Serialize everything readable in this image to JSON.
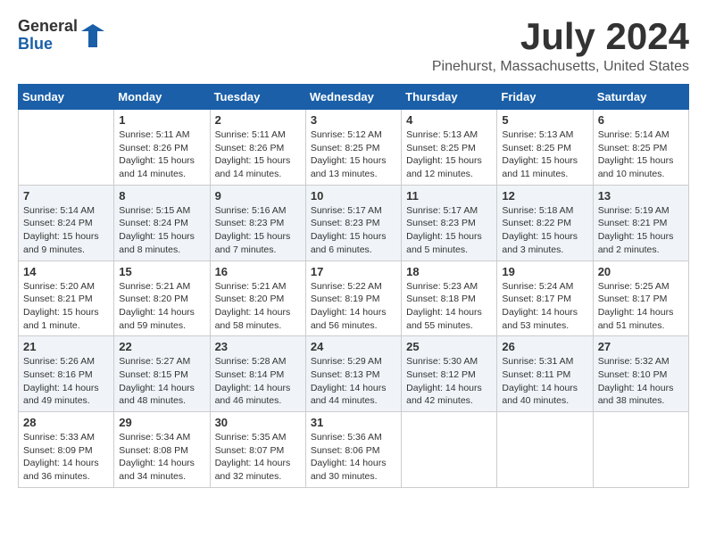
{
  "header": {
    "logo_general": "General",
    "logo_blue": "Blue",
    "month_title": "July 2024",
    "location": "Pinehurst, Massachusetts, United States"
  },
  "days_of_week": [
    "Sunday",
    "Monday",
    "Tuesday",
    "Wednesday",
    "Thursday",
    "Friday",
    "Saturday"
  ],
  "weeks": [
    [
      {
        "day": "",
        "info": ""
      },
      {
        "day": "1",
        "info": "Sunrise: 5:11 AM\nSunset: 8:26 PM\nDaylight: 15 hours\nand 14 minutes."
      },
      {
        "day": "2",
        "info": "Sunrise: 5:11 AM\nSunset: 8:26 PM\nDaylight: 15 hours\nand 14 minutes."
      },
      {
        "day": "3",
        "info": "Sunrise: 5:12 AM\nSunset: 8:25 PM\nDaylight: 15 hours\nand 13 minutes."
      },
      {
        "day": "4",
        "info": "Sunrise: 5:13 AM\nSunset: 8:25 PM\nDaylight: 15 hours\nand 12 minutes."
      },
      {
        "day": "5",
        "info": "Sunrise: 5:13 AM\nSunset: 8:25 PM\nDaylight: 15 hours\nand 11 minutes."
      },
      {
        "day": "6",
        "info": "Sunrise: 5:14 AM\nSunset: 8:25 PM\nDaylight: 15 hours\nand 10 minutes."
      }
    ],
    [
      {
        "day": "7",
        "info": "Sunrise: 5:14 AM\nSunset: 8:24 PM\nDaylight: 15 hours\nand 9 minutes."
      },
      {
        "day": "8",
        "info": "Sunrise: 5:15 AM\nSunset: 8:24 PM\nDaylight: 15 hours\nand 8 minutes."
      },
      {
        "day": "9",
        "info": "Sunrise: 5:16 AM\nSunset: 8:23 PM\nDaylight: 15 hours\nand 7 minutes."
      },
      {
        "day": "10",
        "info": "Sunrise: 5:17 AM\nSunset: 8:23 PM\nDaylight: 15 hours\nand 6 minutes."
      },
      {
        "day": "11",
        "info": "Sunrise: 5:17 AM\nSunset: 8:23 PM\nDaylight: 15 hours\nand 5 minutes."
      },
      {
        "day": "12",
        "info": "Sunrise: 5:18 AM\nSunset: 8:22 PM\nDaylight: 15 hours\nand 3 minutes."
      },
      {
        "day": "13",
        "info": "Sunrise: 5:19 AM\nSunset: 8:21 PM\nDaylight: 15 hours\nand 2 minutes."
      }
    ],
    [
      {
        "day": "14",
        "info": "Sunrise: 5:20 AM\nSunset: 8:21 PM\nDaylight: 15 hours\nand 1 minute."
      },
      {
        "day": "15",
        "info": "Sunrise: 5:21 AM\nSunset: 8:20 PM\nDaylight: 14 hours\nand 59 minutes."
      },
      {
        "day": "16",
        "info": "Sunrise: 5:21 AM\nSunset: 8:20 PM\nDaylight: 14 hours\nand 58 minutes."
      },
      {
        "day": "17",
        "info": "Sunrise: 5:22 AM\nSunset: 8:19 PM\nDaylight: 14 hours\nand 56 minutes."
      },
      {
        "day": "18",
        "info": "Sunrise: 5:23 AM\nSunset: 8:18 PM\nDaylight: 14 hours\nand 55 minutes."
      },
      {
        "day": "19",
        "info": "Sunrise: 5:24 AM\nSunset: 8:17 PM\nDaylight: 14 hours\nand 53 minutes."
      },
      {
        "day": "20",
        "info": "Sunrise: 5:25 AM\nSunset: 8:17 PM\nDaylight: 14 hours\nand 51 minutes."
      }
    ],
    [
      {
        "day": "21",
        "info": "Sunrise: 5:26 AM\nSunset: 8:16 PM\nDaylight: 14 hours\nand 49 minutes."
      },
      {
        "day": "22",
        "info": "Sunrise: 5:27 AM\nSunset: 8:15 PM\nDaylight: 14 hours\nand 48 minutes."
      },
      {
        "day": "23",
        "info": "Sunrise: 5:28 AM\nSunset: 8:14 PM\nDaylight: 14 hours\nand 46 minutes."
      },
      {
        "day": "24",
        "info": "Sunrise: 5:29 AM\nSunset: 8:13 PM\nDaylight: 14 hours\nand 44 minutes."
      },
      {
        "day": "25",
        "info": "Sunrise: 5:30 AM\nSunset: 8:12 PM\nDaylight: 14 hours\nand 42 minutes."
      },
      {
        "day": "26",
        "info": "Sunrise: 5:31 AM\nSunset: 8:11 PM\nDaylight: 14 hours\nand 40 minutes."
      },
      {
        "day": "27",
        "info": "Sunrise: 5:32 AM\nSunset: 8:10 PM\nDaylight: 14 hours\nand 38 minutes."
      }
    ],
    [
      {
        "day": "28",
        "info": "Sunrise: 5:33 AM\nSunset: 8:09 PM\nDaylight: 14 hours\nand 36 minutes."
      },
      {
        "day": "29",
        "info": "Sunrise: 5:34 AM\nSunset: 8:08 PM\nDaylight: 14 hours\nand 34 minutes."
      },
      {
        "day": "30",
        "info": "Sunrise: 5:35 AM\nSunset: 8:07 PM\nDaylight: 14 hours\nand 32 minutes."
      },
      {
        "day": "31",
        "info": "Sunrise: 5:36 AM\nSunset: 8:06 PM\nDaylight: 14 hours\nand 30 minutes."
      },
      {
        "day": "",
        "info": ""
      },
      {
        "day": "",
        "info": ""
      },
      {
        "day": "",
        "info": ""
      }
    ]
  ]
}
